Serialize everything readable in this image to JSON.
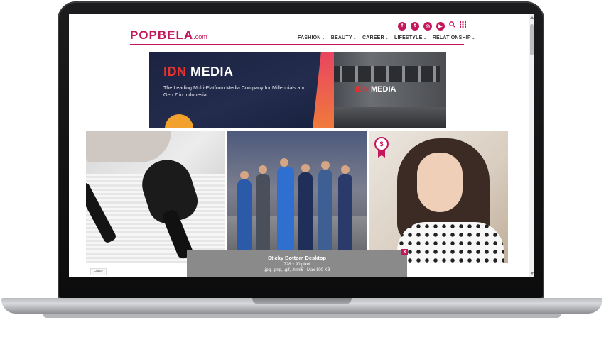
{
  "site": {
    "logo_main": "POPBELA",
    "logo_suffix": ".com"
  },
  "social": [
    {
      "icon": "facebook-icon",
      "glyph": "f"
    },
    {
      "icon": "twitter-icon",
      "glyph": "t"
    },
    {
      "icon": "instagram-icon",
      "glyph": "◎"
    },
    {
      "icon": "youtube-icon",
      "glyph": "▶"
    },
    {
      "icon": "search-icon",
      "glyph": "🔍"
    },
    {
      "icon": "grid-menu-icon",
      "glyph": "▦"
    }
  ],
  "nav": [
    {
      "label": "FASHION"
    },
    {
      "label": "BEAUTY"
    },
    {
      "label": "CAREER"
    },
    {
      "label": "LIFESTYLE"
    },
    {
      "label": "RELATIONSHIP"
    }
  ],
  "banner": {
    "brand_idn": "IDN",
    "brand_media": " MEDIA",
    "tagline": "The Leading Multi-Platform Media Company for Millennials and Gen Z in Indonesia"
  },
  "photo_tag": "HAIR",
  "sticky_ad": {
    "title": "Sticky Bottom Desktop",
    "size": "728 x 90 pixel",
    "formats": ".jpg, .png, .gif, .html5 | Max 100 KB",
    "close": "×"
  },
  "colors": {
    "accent": "#c2185b",
    "banner_bg": "#1f2740",
    "idn_red": "#e8322f"
  }
}
